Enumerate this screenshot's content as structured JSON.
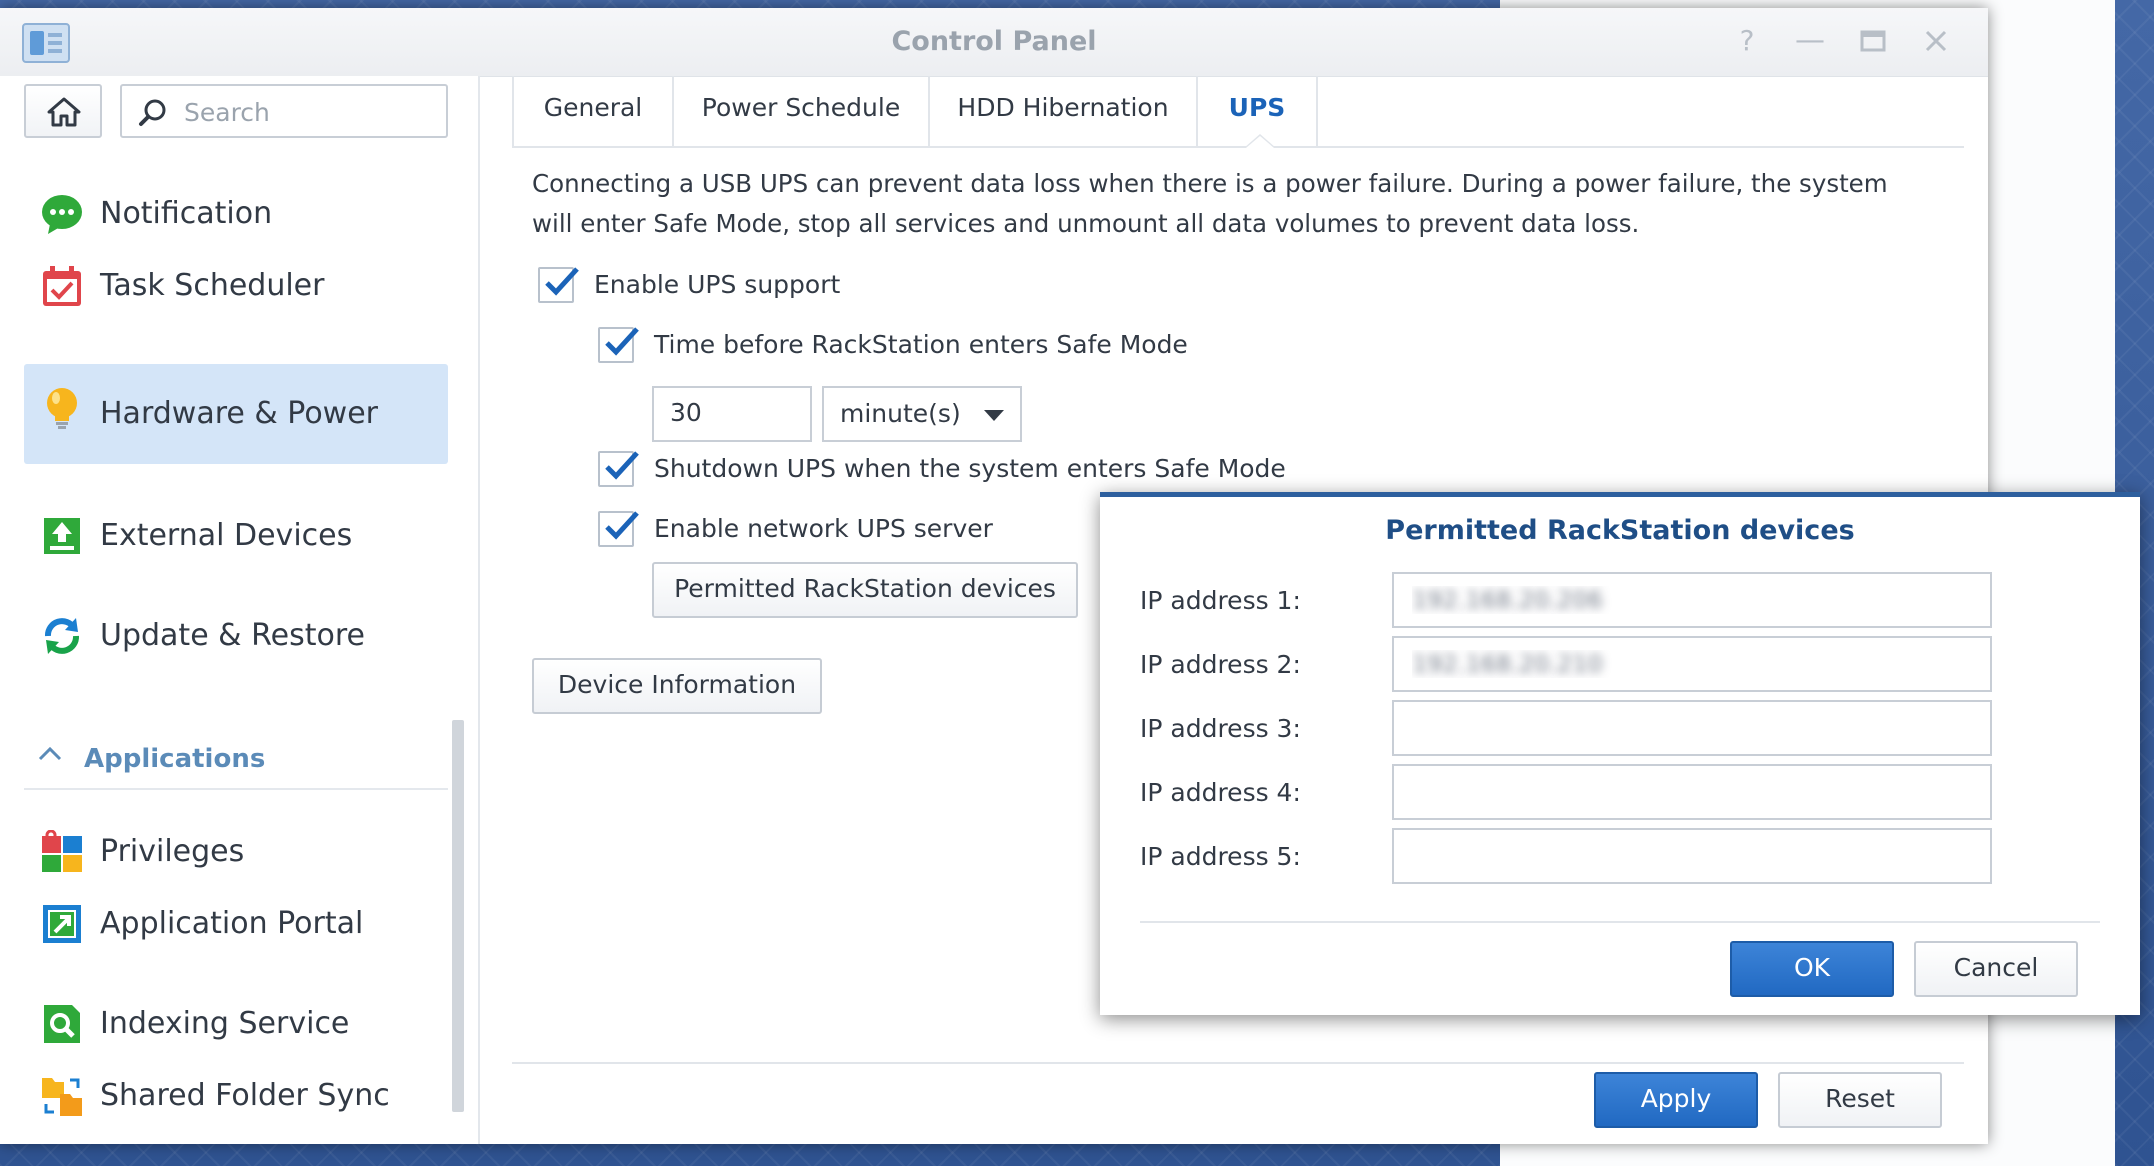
{
  "window": {
    "title": "Control Panel",
    "controls": [
      "help-icon",
      "minimize-icon",
      "maximize-icon",
      "close-icon"
    ]
  },
  "sidebar": {
    "search_placeholder": "Search",
    "items": [
      {
        "label": "Notification",
        "icon": "notification-icon",
        "active": false
      },
      {
        "label": "Task Scheduler",
        "icon": "task-scheduler-icon",
        "active": false
      },
      {
        "label": "Hardware & Power",
        "icon": "lightbulb-icon",
        "active": true
      },
      {
        "label": "External Devices",
        "icon": "external-devices-icon",
        "active": false
      },
      {
        "label": "Update & Restore",
        "icon": "update-restore-icon",
        "active": false
      }
    ],
    "section_label": "Applications",
    "app_items": [
      {
        "label": "Privileges",
        "icon": "privileges-icon"
      },
      {
        "label": "Application Portal",
        "icon": "application-portal-icon"
      },
      {
        "label": "Indexing Service",
        "icon": "indexing-service-icon"
      },
      {
        "label": "Shared Folder Sync",
        "icon": "shared-folder-sync-icon"
      }
    ]
  },
  "tabs": [
    {
      "label": "General",
      "active": false
    },
    {
      "label": "Power Schedule",
      "active": false
    },
    {
      "label": "HDD Hibernation",
      "active": false
    },
    {
      "label": "UPS",
      "active": true
    }
  ],
  "ups": {
    "description": "Connecting a USB UPS can prevent data loss when there is a power failure. During a power failure, the system will enter Safe Mode, stop all services and unmount all data volumes to prevent data loss.",
    "enable_ups_label": "Enable UPS support",
    "enable_ups_checked": true,
    "time_before_label": "Time before RackStation enters Safe Mode",
    "time_before_checked": true,
    "time_value": "30",
    "time_unit": "minute(s)",
    "shutdown_label": "Shutdown UPS when the system enters Safe Mode",
    "shutdown_checked": true,
    "network_server_label": "Enable network UPS server",
    "network_server_checked": true,
    "permitted_button": "Permitted RackStation devices",
    "device_info_button": "Device Information"
  },
  "footer": {
    "apply_label": "Apply",
    "reset_label": "Reset"
  },
  "dialog": {
    "title": "Permitted RackStation devices",
    "fields": [
      {
        "label": "IP address 1:",
        "value": "192.168.20.206"
      },
      {
        "label": "IP address 2:",
        "value": "192.168.20.210"
      },
      {
        "label": "IP address 3:",
        "value": ""
      },
      {
        "label": "IP address 4:",
        "value": ""
      },
      {
        "label": "IP address 5:",
        "value": ""
      }
    ],
    "ok_label": "OK",
    "cancel_label": "Cancel"
  },
  "colors": {
    "accent": "#1b63b8",
    "active_item_bg": "#d4e5f8",
    "dialog_title": "#1f4e86",
    "primary_button": "#2169c2"
  }
}
